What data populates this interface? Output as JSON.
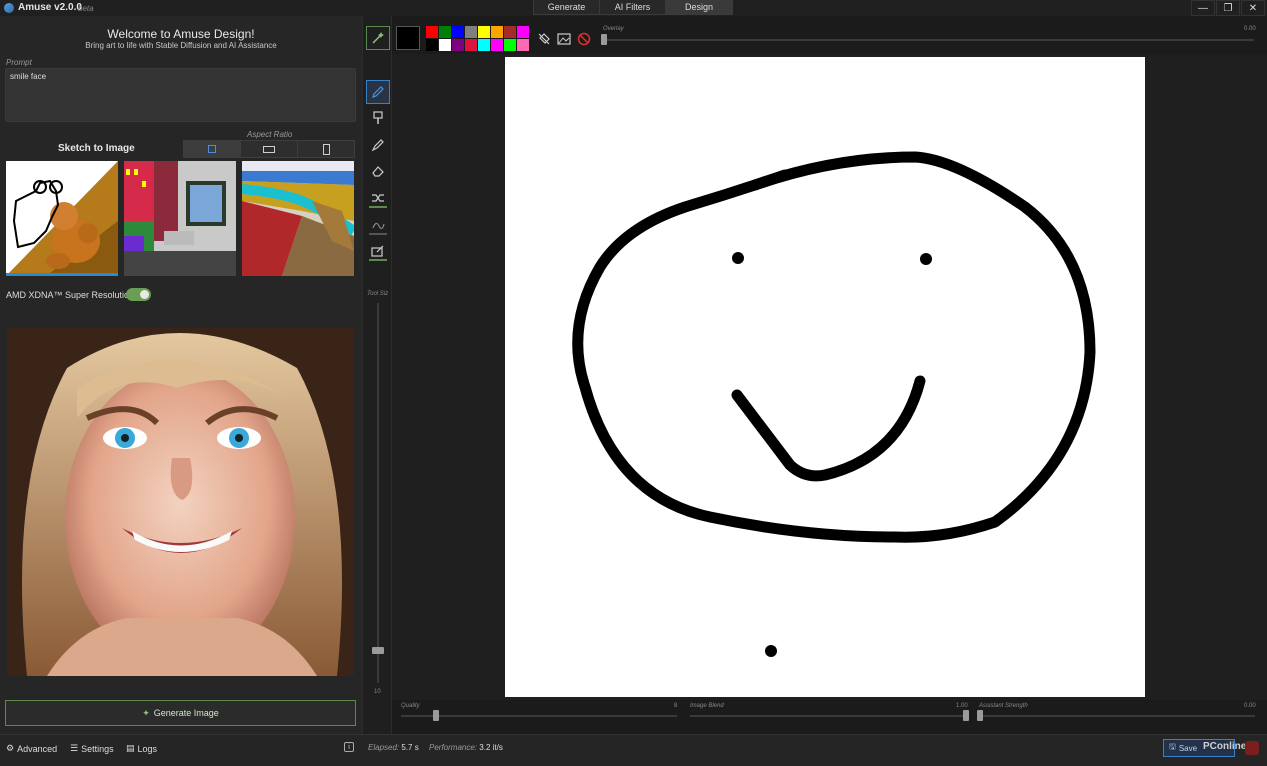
{
  "app": {
    "name": "Amuse v2.0.0",
    "beta": "beta"
  },
  "modes": [
    "Generate",
    "AI Filters",
    "Design"
  ],
  "window_controls": {
    "minimize": "—",
    "restore": "❐",
    "close": "✕"
  },
  "welcome": {
    "title": "Welcome to Amuse Design!",
    "subtitle": "Bring art to life with Stable Diffusion and AI Assistance"
  },
  "prompt": {
    "label": "Prompt",
    "value": "smile face"
  },
  "sketch": {
    "label": "Sketch to Image",
    "aspect_label": "Aspect Ratio",
    "aspect_selected": "square"
  },
  "super_resolution": {
    "label": "AMD XDNA™ Super Resolution",
    "enabled": true
  },
  "generate_button": "Generate Image",
  "toolbar": {
    "tool_size_label": "Tool Siz",
    "tool_size_value": "10"
  },
  "palette": {
    "selected": "#000000",
    "colors": [
      "#ff0000",
      "#008000",
      "#0000ff",
      "#808080",
      "#ffff00",
      "#ffa500",
      "#a52a2a",
      "#ff00ff",
      "#000000",
      "#ffffff",
      "#800080",
      "#dc143c",
      "#00ffff",
      "#ff00ff",
      "#00ff00",
      "#ff69b4"
    ]
  },
  "overlay": {
    "label": "Overlay",
    "value": "0.00"
  },
  "sliders": {
    "quality": {
      "label": "Quality",
      "value": "8"
    },
    "image_blend": {
      "label": "Image Blend",
      "value": "1.00"
    },
    "assistant_strength": {
      "label": "Assistant Strength",
      "value": "0.00"
    }
  },
  "status": {
    "advanced": "Advanced",
    "settings": "Settings",
    "logs": "Logs",
    "info": "i",
    "elapsed_label": "Elapsed:",
    "elapsed_value": "5.7 s",
    "performance_label": "Performance:",
    "performance_value": "3.2 it/s",
    "save": "Save",
    "watermark": "PConline"
  }
}
